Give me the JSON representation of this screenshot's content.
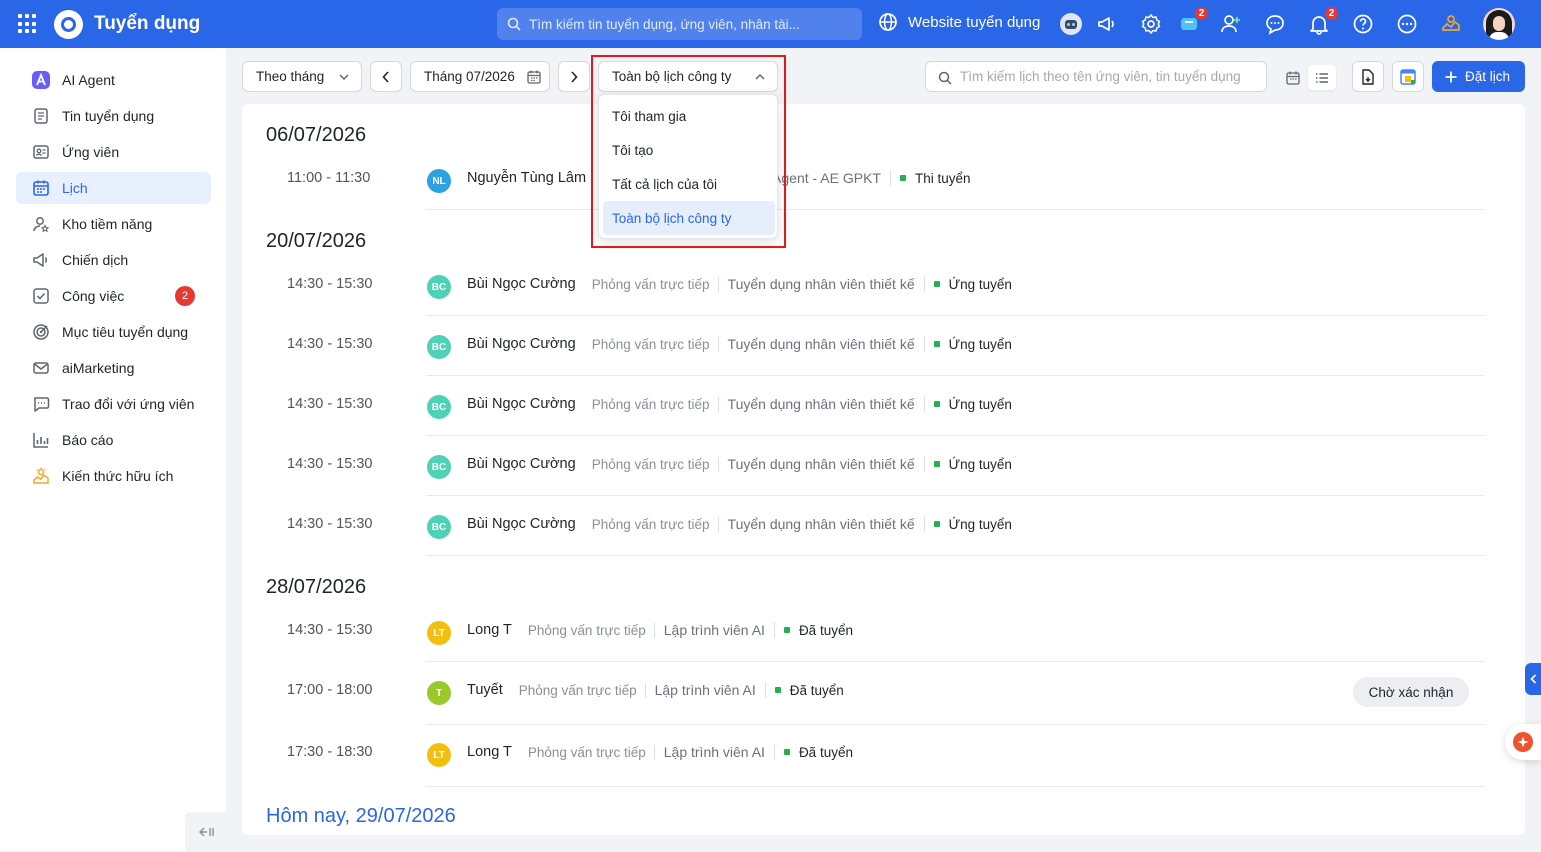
{
  "app": {
    "title": "Tuyển dụng"
  },
  "topbar": {
    "search_placeholder": "Tìm kiếm tin tuyển dụng, ứng viên, nhân tài...",
    "website_label": "Website tuyển dụng",
    "cart_badge": "2",
    "bell_badge": "2"
  },
  "sidebar": {
    "items": [
      {
        "label": "AI Agent"
      },
      {
        "label": "Tin tuyển dụng"
      },
      {
        "label": "Ứng viên"
      },
      {
        "label": "Lịch"
      },
      {
        "label": "Kho tiềm năng"
      },
      {
        "label": "Chiến dịch"
      },
      {
        "label": "Công việc",
        "badge": "2"
      },
      {
        "label": "Mục tiêu tuyển dụng"
      },
      {
        "label": "aiMarketing"
      },
      {
        "label": "Trao đổi với ứng viên"
      },
      {
        "label": "Báo cáo"
      },
      {
        "label": "Kiến thức hữu ích"
      }
    ]
  },
  "toolbar": {
    "view_mode": "Theo tháng",
    "month": "Tháng 07/2026",
    "scope": "Toàn bộ lịch công ty",
    "search_placeholder": "Tìm kiếm lịch theo tên ứng viên, tin tuyển dụng",
    "book_label": "Đặt lịch"
  },
  "dropdown": {
    "options": [
      "Tôi tham gia",
      "Tôi tạo",
      "Tất cả lịch của tôi",
      "Toàn bộ lịch công ty"
    ]
  },
  "schedule": {
    "groups": [
      {
        "date": "06/07/2026",
        "events": [
          {
            "time": "11:00 - 11:30",
            "initials": "NL",
            "name": "Nguyễn Tùng Lâm",
            "job_tail": "Agent - AE GPKT",
            "stage": "Thi tuyển"
          }
        ]
      },
      {
        "date": "20/07/2026",
        "events": [
          {
            "time": "14:30 - 15:30",
            "initials": "BC",
            "name": "Bùi Ngọc Cường",
            "type": "Phỏng vấn trực tiếp",
            "job": "Tuyển dụng nhân viên thiết kế",
            "stage": "Ứng tuyển"
          },
          {
            "time": "14:30 - 15:30",
            "initials": "BC",
            "name": "Bùi Ngọc Cường",
            "type": "Phỏng vấn trực tiếp",
            "job": "Tuyển dụng nhân viên thiết kế",
            "stage": "Ứng tuyển"
          },
          {
            "time": "14:30 - 15:30",
            "initials": "BC",
            "name": "Bùi Ngọc Cường",
            "type": "Phỏng vấn trực tiếp",
            "job": "Tuyển dụng nhân viên thiết kế",
            "stage": "Ứng tuyển"
          },
          {
            "time": "14:30 - 15:30",
            "initials": "BC",
            "name": "Bùi Ngọc Cường",
            "type": "Phỏng vấn trực tiếp",
            "job": "Tuyển dụng nhân viên thiết kế",
            "stage": "Ứng tuyển"
          },
          {
            "time": "14:30 - 15:30",
            "initials": "BC",
            "name": "Bùi Ngọc Cường",
            "type": "Phỏng vấn trực tiếp",
            "job": "Tuyển dụng nhân viên thiết kế",
            "stage": "Ứng tuyển"
          }
        ]
      },
      {
        "date": "28/07/2026",
        "events": [
          {
            "time": "14:30 - 15:30",
            "initials": "LT",
            "name": "Long T",
            "type": "Phỏng vấn trực tiếp",
            "job": "Lập trình viên AI",
            "stage": "Đã tuyển"
          },
          {
            "time": "17:00 - 18:00",
            "initials": "T",
            "name": "Tuyết",
            "type": "Phỏng vấn trực tiếp",
            "job": "Lập trình viên AI",
            "stage": "Đã tuyển",
            "status": "Chờ xác nhận"
          },
          {
            "time": "17:30 - 18:30",
            "initials": "LT",
            "name": "Long T",
            "type": "Phỏng vấn trực tiếp",
            "job": "Lập trình viên AI",
            "stage": "Đã tuyển"
          }
        ]
      }
    ],
    "today": "Hôm nay, 29/07/2026"
  },
  "colors": {
    "primary": "#2a66e8",
    "avatar_nl": "#2aa3e0",
    "avatar_bc": "#4fd1b5",
    "avatar_lt": "#f2bf11",
    "avatar_t": "#9bc92b",
    "stage_dot": "#22b14c",
    "highlight": "#e01a1a"
  }
}
